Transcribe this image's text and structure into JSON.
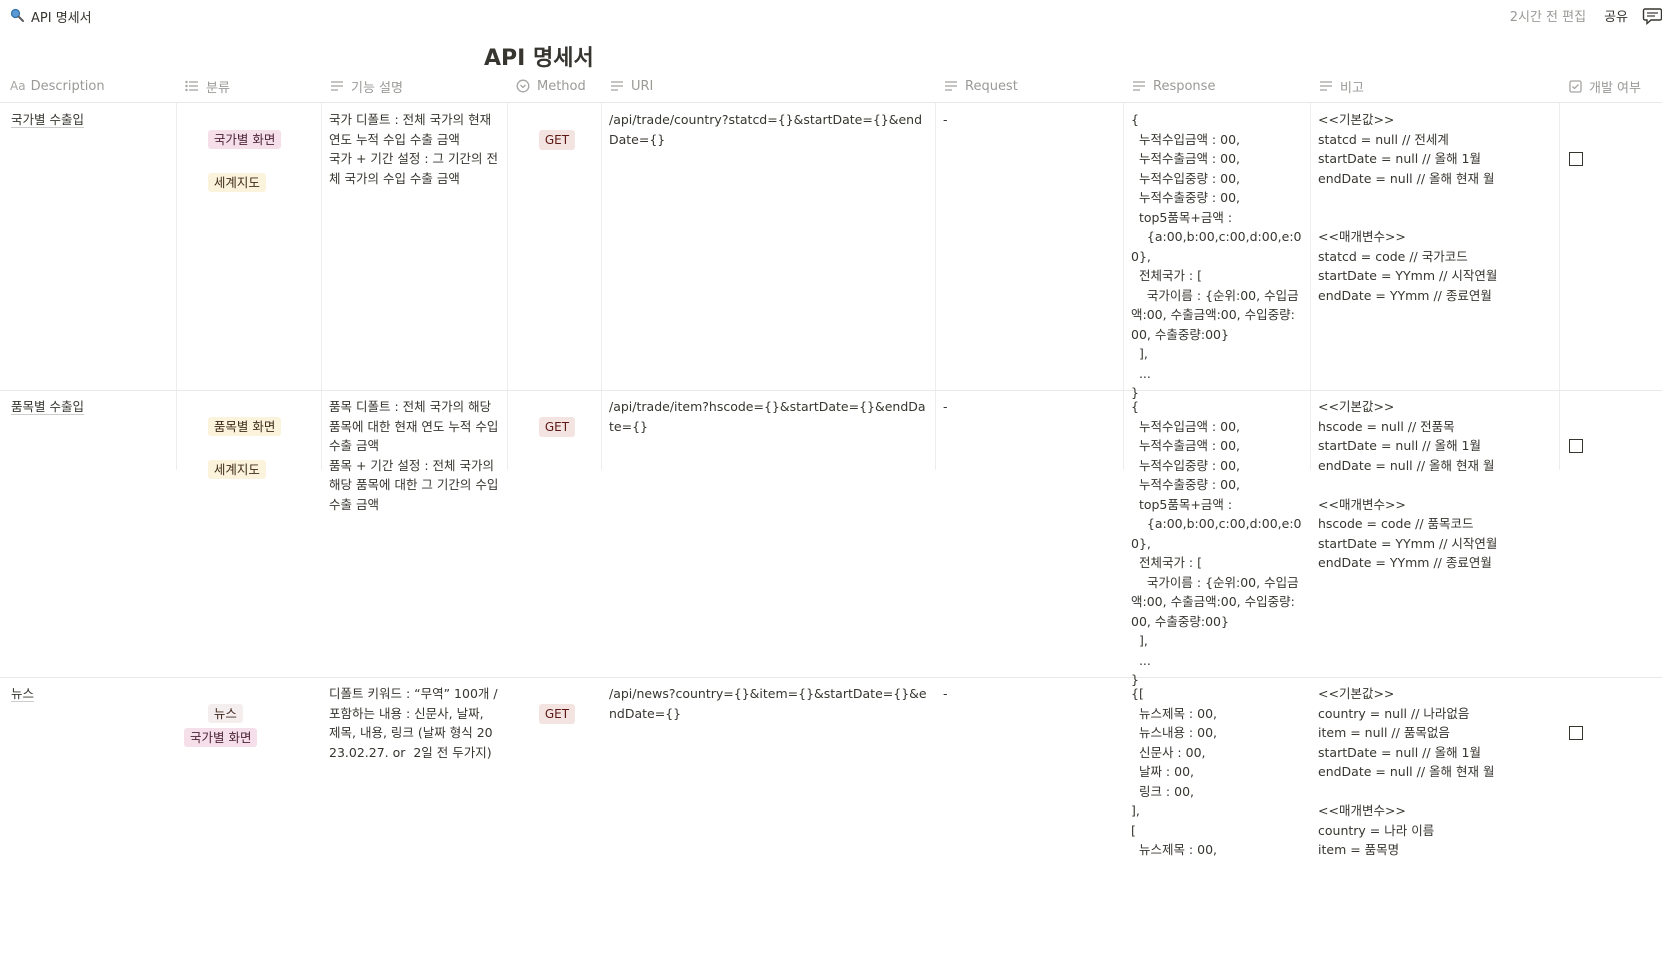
{
  "topbar": {
    "page_name": "API 명세서",
    "edited": "2시간 전 편집",
    "share": "공유"
  },
  "title": "API 명세서",
  "columns": [
    {
      "label": "Description",
      "icon": "title-icon"
    },
    {
      "label": "분류",
      "icon": "multi-select-icon"
    },
    {
      "label": "기능 설명",
      "icon": "text-icon"
    },
    {
      "label": "Method",
      "icon": "select-icon"
    },
    {
      "label": "URI",
      "icon": "text-icon"
    },
    {
      "label": "Request",
      "icon": "text-icon"
    },
    {
      "label": "Response",
      "icon": "text-icon"
    },
    {
      "label": "비고",
      "icon": "text-icon"
    },
    {
      "label": "개발 여부",
      "icon": "checkbox-icon"
    }
  ],
  "rows": [
    {
      "description": "국가별 수출입",
      "tags": [
        "국가별 화면",
        "세계지도"
      ],
      "feature": "국가 디폴트 : 전체 국가의 현재 연도 누적 수입 수출 금액\n국가 + 기간 설정 : 그 기간의 전체 국가의 수입 수출 금액",
      "method": "GET",
      "uri": "/api/trade/country?statcd={}&startDate={}&endDate={}",
      "request": "-",
      "response": "{\n  누적수입금액 : 00,\n  누적수출금액 : 00,\n  누적수입중량 : 00,\n  누적수출중량 : 00,\n  top5품목+금액 :\n    {a:00,b:00,c:00,d:00,e:00},\n  전체국가 : [\n    국가이름 : {순위:00, 수입금액:00, 수출금액:00, 수입중량:00, 수출중량:00}\n  ],\n  ...\n}",
      "note": "<<기본값>>\nstatcd = null // 전세계\nstartDate = null // 올해 1월\nendDate = null // 올해 현재 월\n\n\n<<매개변수>>\nstatcd = code // 국가코드\nstartDate = YYmm // 시작연월\nendDate = YYmm // 종료연월",
      "done": false
    },
    {
      "description": "품목별 수출입",
      "tags": [
        "품목별 화면",
        "세계지도"
      ],
      "feature": "품목 디폴트 : 전체 국가의 해당 품목에 대한 현재 연도 누적 수입 수출 금액\n품목 + 기간 설정 : 전체 국가의 해당 품목에 대한 그 기간의 수입 수출 금액",
      "method": "GET",
      "uri": "/api/trade/item?hscode={}&startDate={}&endDate={}",
      "request": "-",
      "response": "{\n  누적수입금액 : 00,\n  누적수출금액 : 00,\n  누적수입중량 : 00,\n  누적수출중량 : 00,\n  top5품목+금액 :\n    {a:00,b:00,c:00,d:00,e:00},\n  전체국가 : [\n    국가이름 : {순위:00, 수입금액:00, 수출금액:00, 수입중량:00, 수출중량:00}\n  ],\n  ...\n}",
      "note": "<<기본값>>\nhscode = null // 전품목\nstartDate = null // 올해 1월\nendDate = null // 올해 현재 월\n\n<<매개변수>>\nhscode = code // 품목코드\nstartDate = YYmm // 시작연월\nendDate = YYmm // 종료연월",
      "done": false
    },
    {
      "description": "뉴스",
      "tags": [
        "뉴스",
        "국가별 화면"
      ],
      "feature": "디폴트 키워드 : “무역” 100개 / 포함하는 내용 : 신문사, 날짜, 제목, 내용, 링크 (날짜 형식 2023.02.27. or  2일 전 두가지)",
      "method": "GET",
      "uri": "/api/news?country={}&item={}&startDate={}&endDate={}",
      "request": "-",
      "response": "{[\n  뉴스제목 : 00,\n  뉴스내용 : 00,\n  신문사 : 00,\n  날짜 : 00,\n  링크 : 00,\n],\n[\n  뉴스제목 : 00,",
      "note": "<<기본값>>\ncountry = null // 나라없음\nitem = null // 품목없음\nstartDate = null // 올해 1월\nendDate = null // 올해 현재 월\n\n<<매개변수>>\ncountry = 나라 이름\nitem = 품목명",
      "done": false
    }
  ],
  "tag_colors": {
    "국가별 화면": "#f5e0e9",
    "세계지도": "#fbf3db",
    "품목별 화면": "#fbf3db",
    "뉴스": "#f4eeee"
  }
}
